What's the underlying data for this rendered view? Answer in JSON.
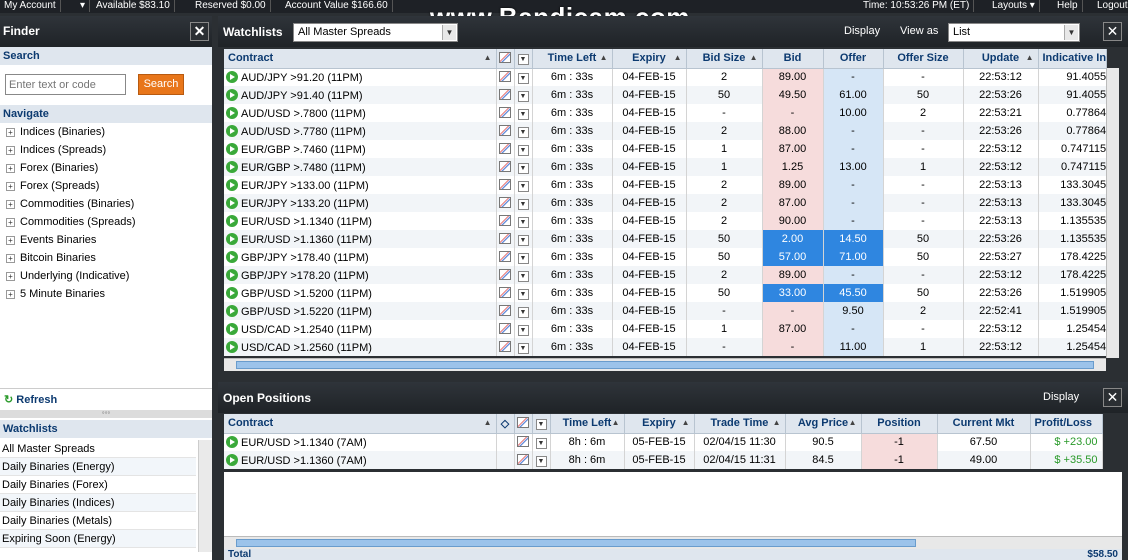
{
  "topbar": {
    "my_account": "My Account",
    "available": "Available $83.10",
    "reserved": "Reserved $0.00",
    "account_value": "Account Value $166.60",
    "time": "Time: 10:53:26 PM (ET)",
    "layouts": "Layouts ▾",
    "help": "Help",
    "logout": "Logout"
  },
  "watermark": "www.Bandicam.com",
  "finder": {
    "title": "Finder",
    "search_heading": "Search",
    "search_placeholder": "Enter text or code",
    "search_button": "Search",
    "navigate_heading": "Navigate",
    "nav_items": [
      "Indices (Binaries)",
      "Indices (Spreads)",
      "Forex (Binaries)",
      "Forex (Spreads)",
      "Commodities (Binaries)",
      "Commodities (Spreads)",
      "Events Binaries",
      "Bitcoin Binaries",
      "Underlying (Indicative)",
      "5 Minute Binaries"
    ],
    "refresh": "Refresh",
    "watchlists_heading": "Watchlists",
    "watchlist_items": [
      "All Master Spreads",
      "Daily Binaries (Energy)",
      "Daily Binaries (Forex)",
      "Daily Binaries (Indices)",
      "Daily Binaries (Metals)",
      "Expiring Soon (Energy)"
    ]
  },
  "watchlists": {
    "title": "Watchlists",
    "selected": "All Master Spreads",
    "display": "Display",
    "view_as_label": "View as",
    "view_as": "List",
    "columns": [
      "Contract",
      "Time Left",
      "Expiry",
      "Bid Size",
      "Bid",
      "Offer",
      "Offer Size",
      "Update",
      "Indicative In"
    ],
    "rows": [
      [
        "AUD/JPY >91.20 (11PM)",
        "6m : 33s",
        "04-FEB-15",
        "2",
        "89.00",
        "-",
        "-",
        "22:53:12",
        "91.4055"
      ],
      [
        "AUD/JPY >91.40 (11PM)",
        "6m : 33s",
        "04-FEB-15",
        "50",
        "49.50",
        "61.00",
        "50",
        "22:53:26",
        "91.4055"
      ],
      [
        "AUD/USD >.7800 (11PM)",
        "6m : 33s",
        "04-FEB-15",
        "-",
        "-",
        "10.00",
        "2",
        "22:53:21",
        "0.77864"
      ],
      [
        "AUD/USD >.7780 (11PM)",
        "6m : 33s",
        "04-FEB-15",
        "2",
        "88.00",
        "-",
        "-",
        "22:53:26",
        "0.77864"
      ],
      [
        "EUR/GBP >.7460 (11PM)",
        "6m : 33s",
        "04-FEB-15",
        "1",
        "87.00",
        "-",
        "-",
        "22:53:12",
        "0.747115"
      ],
      [
        "EUR/GBP >.7480 (11PM)",
        "6m : 33s",
        "04-FEB-15",
        "1",
        "1.25",
        "13.00",
        "1",
        "22:53:12",
        "0.747115"
      ],
      [
        "EUR/JPY >133.00 (11PM)",
        "6m : 33s",
        "04-FEB-15",
        "2",
        "89.00",
        "-",
        "-",
        "22:53:13",
        "133.3045"
      ],
      [
        "EUR/JPY >133.20 (11PM)",
        "6m : 33s",
        "04-FEB-15",
        "2",
        "87.00",
        "-",
        "-",
        "22:53:13",
        "133.3045"
      ],
      [
        "EUR/USD >1.1340 (11PM)",
        "6m : 33s",
        "04-FEB-15",
        "2",
        "90.00",
        "-",
        "-",
        "22:53:13",
        "1.135535"
      ],
      [
        "EUR/USD >1.1360 (11PM)",
        "6m : 33s",
        "04-FEB-15",
        "50",
        "2.00",
        "14.50",
        "50",
        "22:53:26",
        "1.135535"
      ],
      [
        "GBP/JPY >178.40 (11PM)",
        "6m : 33s",
        "04-FEB-15",
        "50",
        "57.00",
        "71.00",
        "50",
        "22:53:27",
        "178.4225"
      ],
      [
        "GBP/JPY >178.20 (11PM)",
        "6m : 33s",
        "04-FEB-15",
        "2",
        "89.00",
        "-",
        "-",
        "22:53:12",
        "178.4225"
      ],
      [
        "GBP/USD >1.5200 (11PM)",
        "6m : 33s",
        "04-FEB-15",
        "50",
        "33.00",
        "45.50",
        "50",
        "22:53:26",
        "1.519905"
      ],
      [
        "GBP/USD >1.5220 (11PM)",
        "6m : 33s",
        "04-FEB-15",
        "-",
        "-",
        "9.50",
        "2",
        "22:52:41",
        "1.519905"
      ],
      [
        "USD/CAD >1.2540 (11PM)",
        "6m : 33s",
        "04-FEB-15",
        "1",
        "87.00",
        "-",
        "-",
        "22:53:12",
        "1.25454"
      ],
      [
        "USD/CAD >1.2560 (11PM)",
        "6m : 33s",
        "04-FEB-15",
        "-",
        "-",
        "11.00",
        "1",
        "22:53:12",
        "1.25454"
      ]
    ],
    "highlighted_rows": [
      9,
      10,
      12
    ]
  },
  "open_positions": {
    "title": "Open Positions",
    "display": "Display",
    "columns": [
      "Contract",
      "Time Left",
      "Expiry",
      "Trade Time",
      "Avg Price",
      "Position",
      "Current Mkt",
      "Profit/Loss"
    ],
    "rows": [
      [
        "EUR/USD >1.1340 (7AM)",
        "8h : 6m",
        "05-FEB-15",
        "02/04/15 11:30",
        "90.5",
        "-1",
        "67.50",
        "$ +23.00"
      ],
      [
        "EUR/USD >1.1360 (7AM)",
        "8h : 6m",
        "05-FEB-15",
        "02/04/15 11:31",
        "84.5",
        "-1",
        "49.00",
        "$ +35.50"
      ]
    ],
    "total_label": "Total",
    "total_value": "$58.50"
  }
}
